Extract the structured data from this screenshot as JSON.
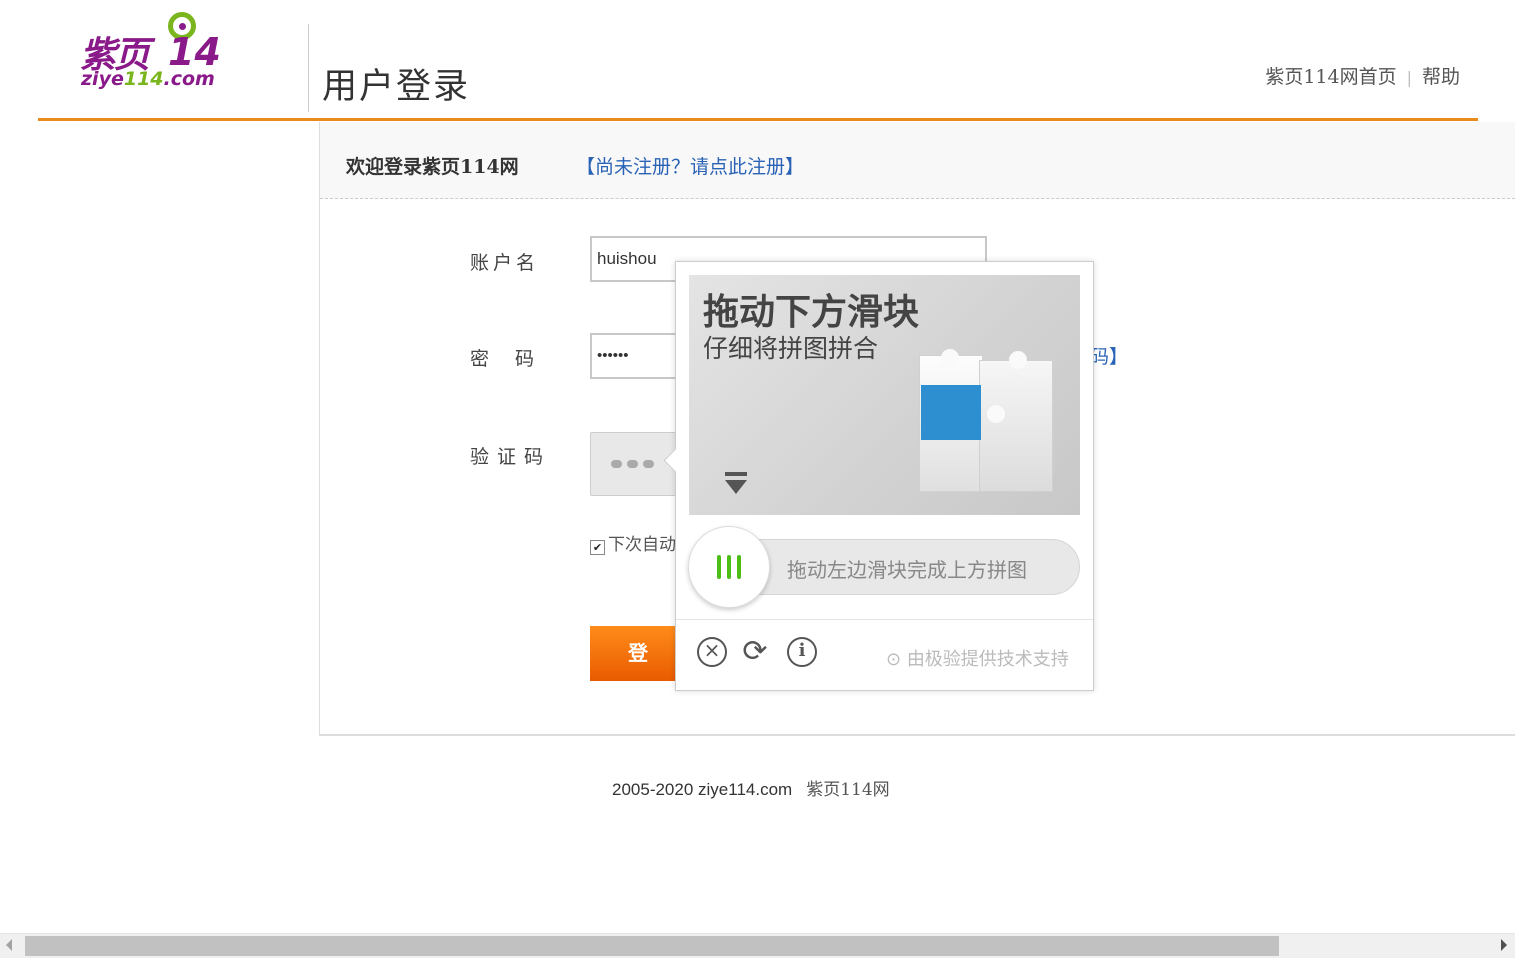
{
  "header": {
    "logo_cn": "紫页",
    "logo_num": "14",
    "logo_en_main": "ziye",
    "logo_en_num": "114",
    "logo_en_tld": ".com",
    "page_title": "用户登录",
    "home_link": "紫页114网首页",
    "separator": "|",
    "help_link": "帮助"
  },
  "welcome": {
    "text": "欢迎登录紫页114网",
    "register_link": "【尚未注册？请点此注册】"
  },
  "form": {
    "username_label": "账户名",
    "username_value": "huishou",
    "password_label": "密 码",
    "password_value": "••••••",
    "captcha_label": "验证码",
    "remember_label": "下次自动",
    "login_button": "登",
    "forgot_tail": "码】"
  },
  "captcha_popup": {
    "title": "拖动下方滑块",
    "subtitle": "仔细将拼图拼合",
    "slider_hint": "拖动左边滑块完成上方拼图",
    "support_text": "由极验提供技术支持",
    "colors": {
      "knob_bars": "#4cbf16",
      "puzzle_blue": "#2d8fd0"
    }
  },
  "footer": {
    "copyright": "2005-2020 ziye114.com",
    "site_name": "紫页114网"
  },
  "colors": {
    "accent_orange": "#e98a1d",
    "link_blue": "#2a63b6",
    "logo_purple": "#8a1a8a",
    "logo_green": "#7ab51d"
  }
}
